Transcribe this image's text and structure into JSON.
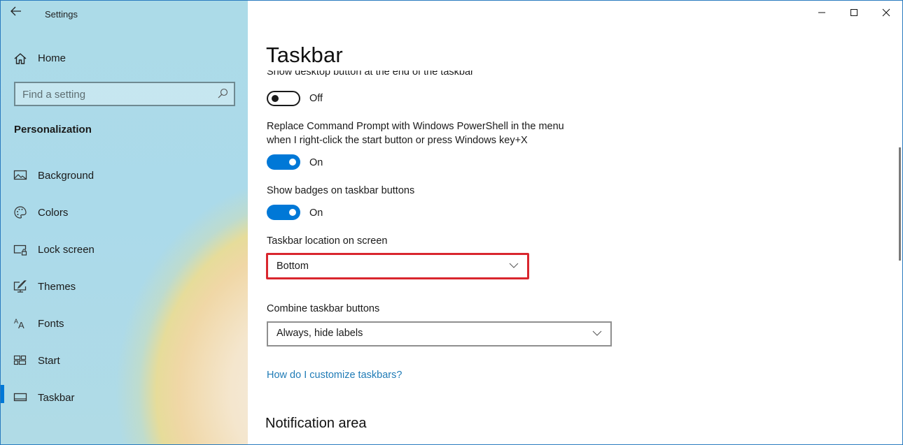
{
  "window": {
    "app_title": "Settings",
    "controls": {
      "minimize": "minimize-icon",
      "maximize": "maximize-icon",
      "close": "close-icon"
    },
    "accent_color": "#0078d7",
    "highlight_color": "#d9262e",
    "link_color": "#1f7bb6"
  },
  "sidebar": {
    "back_icon": "arrow-left-icon",
    "home": {
      "label": "Home",
      "icon": "home-icon"
    },
    "search": {
      "placeholder": "Find a setting",
      "value": "",
      "icon": "search-icon"
    },
    "section": "Personalization",
    "items": [
      {
        "label": "Background",
        "icon": "picture-icon",
        "active": false
      },
      {
        "label": "Colors",
        "icon": "palette-icon",
        "active": false
      },
      {
        "label": "Lock screen",
        "icon": "lock-screen-icon",
        "active": false
      },
      {
        "label": "Themes",
        "icon": "brush-icon",
        "active": false
      },
      {
        "label": "Fonts",
        "icon": "fonts-icon",
        "active": false
      },
      {
        "label": "Start",
        "icon": "start-tiles-icon",
        "active": false
      },
      {
        "label": "Taskbar",
        "icon": "taskbar-icon",
        "active": true
      }
    ]
  },
  "main": {
    "title": "Taskbar",
    "settings": [
      {
        "label": "Show desktop button at the end of the taskbar",
        "state": "Off",
        "on": false
      },
      {
        "label_line1": "Replace Command Prompt with Windows PowerShell in the menu",
        "label_line2": "when I right-click the start button or press Windows key+X",
        "state": "On",
        "on": true
      },
      {
        "label": "Show badges on taskbar buttons",
        "state": "On",
        "on": true
      }
    ],
    "taskbar_location": {
      "label": "Taskbar location on screen",
      "value": "Bottom",
      "highlighted": true
    },
    "combine_buttons": {
      "label": "Combine taskbar buttons",
      "value": "Always, hide labels"
    },
    "help_link": "How do I customize taskbars?",
    "next_section": "Notification area"
  }
}
